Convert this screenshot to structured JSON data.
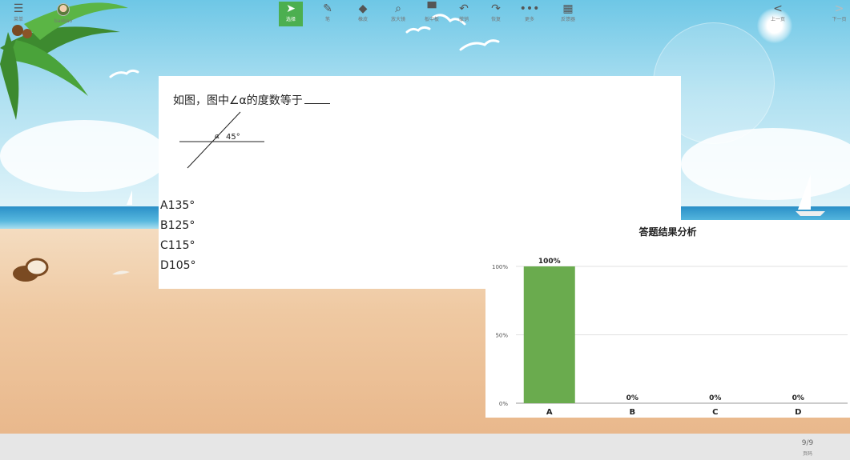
{
  "question": {
    "stem": "如图，图中∠α的度数等于",
    "figure": {
      "angle_alpha_label": "α",
      "angle_known_label": "45°"
    },
    "options": [
      "A135°",
      "B125°",
      "C115°",
      "D105°"
    ]
  },
  "result_panel": {
    "title": "答题结果分析",
    "chart_data": {
      "type": "bar",
      "title": "答题结果分析",
      "categories": [
        "A",
        "B",
        "C",
        "D"
      ],
      "values": [
        100,
        0,
        0,
        0
      ],
      "data_labels": [
        "100%",
        "0%",
        "0%",
        "0%"
      ],
      "y_ticks": [
        "0%",
        "50%",
        "100%"
      ],
      "ylim": [
        0,
        100
      ],
      "grid": true,
      "bar_color": "#6aab4e"
    }
  },
  "toolbar": {
    "menu_label": "菜单",
    "user_name": "baobao",
    "tools": [
      {
        "icon": "cursor-icon",
        "label": "选择",
        "active": true
      },
      {
        "icon": "pen-icon",
        "label": "笔",
        "active": false
      },
      {
        "icon": "eraser-icon",
        "label": "橡皮",
        "active": false
      },
      {
        "icon": "magnifier-icon",
        "label": "放大镜",
        "active": false
      },
      {
        "icon": "blackboard-icon",
        "label": "板中板",
        "active": false
      },
      {
        "icon": "undo-icon",
        "label": "撤销",
        "active": false
      },
      {
        "icon": "redo-icon",
        "label": "恢复",
        "active": false
      },
      {
        "icon": "more-icon",
        "label": "更多",
        "active": false
      },
      {
        "icon": "clicker-icon",
        "label": "反馈器",
        "active": false
      }
    ],
    "prev_label": "上一页",
    "page_label": "页码",
    "next_label": "下一页",
    "page_number": "9/9"
  },
  "colors": {
    "accent": "#4caf50",
    "bar": "#6aab4e"
  }
}
